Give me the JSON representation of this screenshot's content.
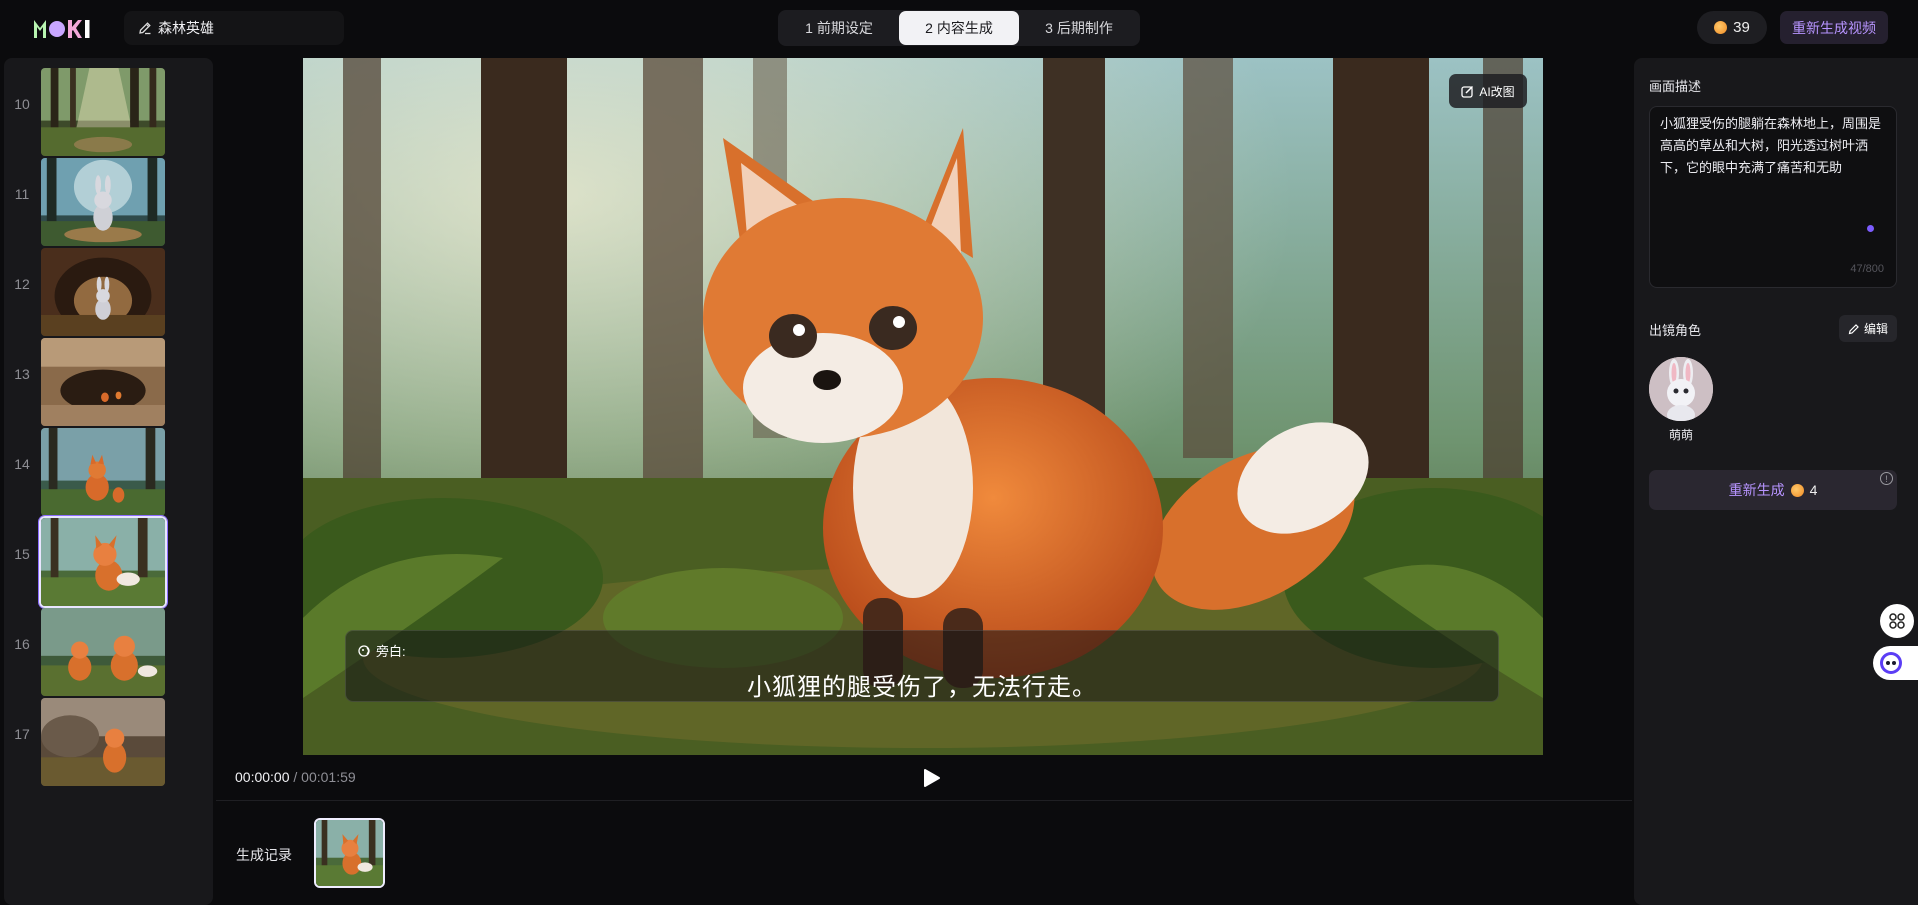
{
  "brand": {
    "logo_text": "MOKI"
  },
  "project": {
    "title": "森林英雄",
    "icon": "pencil-icon"
  },
  "steps": [
    {
      "label": "1 前期设定",
      "active": false
    },
    {
      "label": "2 内容生成",
      "active": true
    },
    {
      "label": "3 后期制作",
      "active": false
    }
  ],
  "coins": {
    "count": "39"
  },
  "header": {
    "regen_video_label": "重新生成视频"
  },
  "shots": [
    {
      "num": "10",
      "scene": "forest-path"
    },
    {
      "num": "11",
      "scene": "rabbit-forest"
    },
    {
      "num": "12",
      "scene": "rabbit-cave"
    },
    {
      "num": "13",
      "scene": "cave-fox"
    },
    {
      "num": "14",
      "scene": "fox-rabbit"
    },
    {
      "num": "15",
      "scene": "fox-forest",
      "selected": true
    },
    {
      "num": "16",
      "scene": "fox-rabbit-pair"
    },
    {
      "num": "17",
      "scene": "fox-rocks"
    }
  ],
  "stage": {
    "ai_edit_label": "AI改图",
    "caption_label": "旁白:",
    "caption_text": "小狐狸的腿受伤了，无法行走。"
  },
  "player": {
    "current": "00:00:00",
    "separator": " / ",
    "total": "00:01:59"
  },
  "history": {
    "label": "生成记录"
  },
  "panel": {
    "desc_title": "画面描述",
    "desc_text": "小狐狸受伤的腿躺在森林地上，周围是高高的草丛和大树，阳光透过树叶洒下，它的眼中充满了痛苦和无助",
    "desc_count": "47/800",
    "roles_title": "出镜角色",
    "edit_label": "编辑",
    "role_name": "萌萌",
    "regen_label": "重新生成",
    "regen_cost": "4",
    "info_glyph": "!"
  },
  "colors": {
    "accent": "#b794ff",
    "accent_dot": "#7c5cff",
    "bg": "#0b0b0d",
    "panel": "#18181b"
  }
}
